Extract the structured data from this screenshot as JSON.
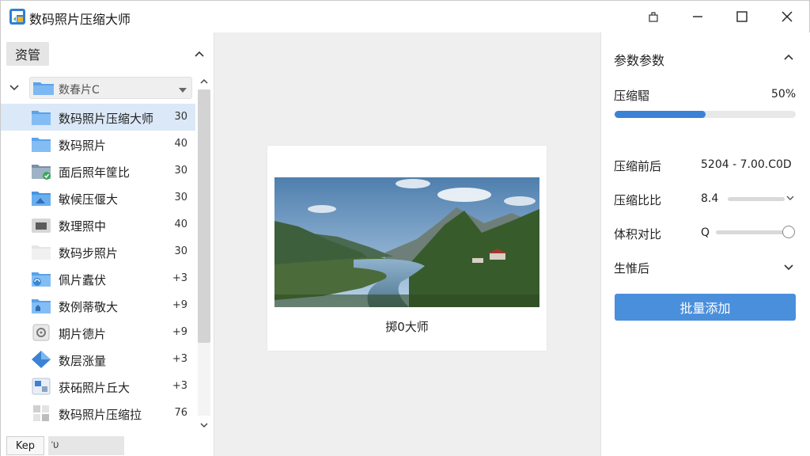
{
  "window": {
    "title": "数码照片压缩大师",
    "accent": "#3b82d4"
  },
  "left_panel": {
    "assets_button": "资管",
    "folder_select": {
      "value": "数春片C"
    },
    "items": [
      {
        "label": "数码照片压缩大师",
        "count": "30",
        "icon": "folder-icon",
        "selected": true
      },
      {
        "label": "数码照片",
        "count": "40",
        "icon": "folder-icon",
        "selected": false
      },
      {
        "label": "面后照年筐比",
        "count": "30",
        "icon": "folder-check-icon",
        "selected": false
      },
      {
        "label": "敏候压偃大",
        "count": "30",
        "icon": "folder-photo-icon",
        "selected": false
      },
      {
        "label": "数理照中",
        "count": "40",
        "icon": "folder-gray-icon",
        "selected": false
      },
      {
        "label": "数码步照片",
        "count": "30",
        "icon": "folder-white-icon",
        "selected": false
      },
      {
        "label": "佩片蠹伏",
        "count": "+3",
        "icon": "folder-sync-icon",
        "selected": false
      },
      {
        "label": "数例蒂敬大",
        "count": "+9",
        "icon": "folder-home-icon",
        "selected": false
      },
      {
        "label": "期片德片",
        "count": "+9",
        "icon": "gear-box-icon",
        "selected": false
      },
      {
        "label": "数层涨量",
        "count": "+3",
        "icon": "diamond-icon",
        "selected": false
      },
      {
        "label": "获砳照片丘大",
        "count": "+3",
        "icon": "image-grid-icon",
        "selected": false
      },
      {
        "label": "数码照片压缩拉",
        "count": "76",
        "icon": "puzzle-icon",
        "selected": false
      }
    ],
    "keep_button": "Kep",
    "bottom_field": "ᡃυ"
  },
  "center": {
    "caption": "掷0大师"
  },
  "right_panel": {
    "title": "参数参数",
    "compression": {
      "label": "压缩騽",
      "value_text": "50%",
      "value": 0.5
    },
    "before_after": {
      "label": "压缩前后",
      "value": "5204 - 7.00.C0D"
    },
    "ratio": {
      "label": "压缩比比",
      "value": "8.4",
      "slider": 0.93
    },
    "volume": {
      "label": "体积对比",
      "value": "Q",
      "slider": 0.95
    },
    "generate": {
      "label": "生惟后"
    },
    "batch_button": "批量添加"
  }
}
